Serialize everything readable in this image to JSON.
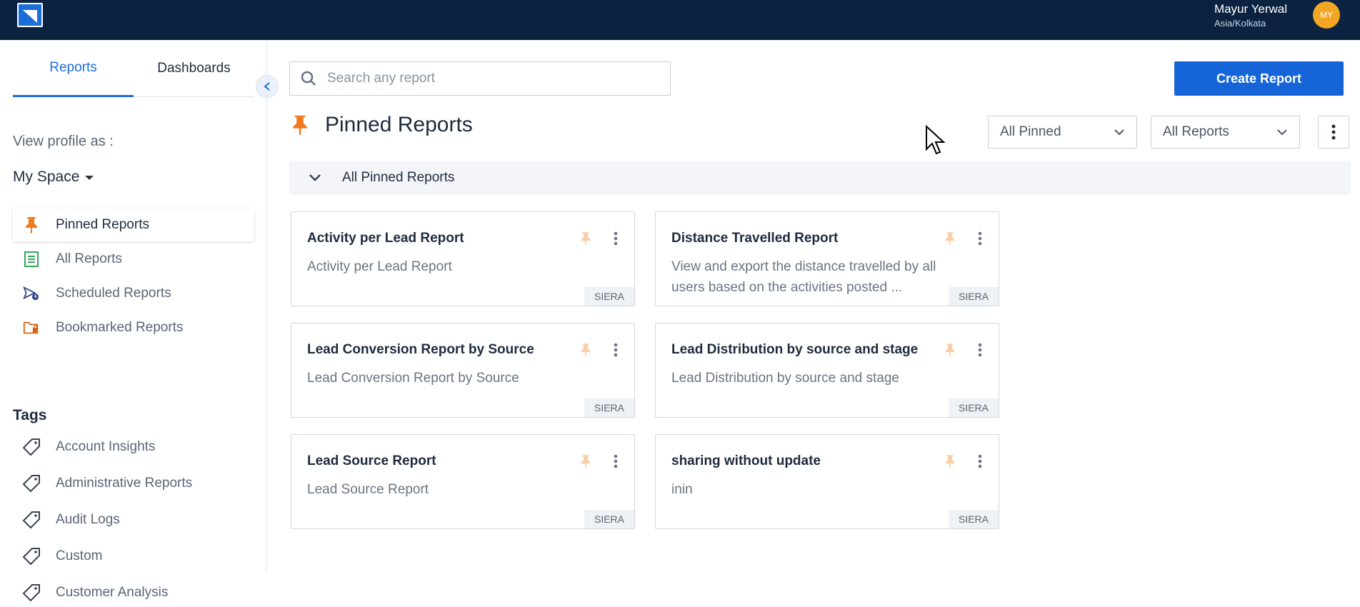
{
  "topbar": {
    "user_name": "Mayur Yerwal",
    "user_timezone": "Asia/Kolkata",
    "avatar_initials": "MY",
    "bg_color": "#0b2341",
    "avatar_color": "#f2a623"
  },
  "sidebar": {
    "tabs": [
      {
        "label": "Reports",
        "active": true
      },
      {
        "label": "Dashboards",
        "active": false
      }
    ],
    "view_profile_label": "View profile as :",
    "space_label": "My Space",
    "nav_items": [
      {
        "label": "Pinned Reports",
        "icon": "pin-icon",
        "active": true
      },
      {
        "label": "All Reports",
        "icon": "document-list-icon",
        "active": false
      },
      {
        "label": "Scheduled Reports",
        "icon": "send-clock-icon",
        "active": false
      },
      {
        "label": "Bookmarked Reports",
        "icon": "folder-lock-icon",
        "active": false
      }
    ],
    "tags_title": "Tags",
    "tags": [
      {
        "label": "Account Insights"
      },
      {
        "label": "Administrative Reports"
      },
      {
        "label": "Audit Logs"
      },
      {
        "label": "Custom"
      },
      {
        "label": "Customer Analysis"
      }
    ]
  },
  "main": {
    "search_placeholder": "Search any report",
    "create_button_label": "Create Report",
    "page_title": "Pinned Reports",
    "filter_pinned": "All Pinned",
    "filter_reports": "All Reports",
    "group_label": "All Pinned Reports",
    "accent_color": "#1565d8",
    "pin_color": "#f07b1d",
    "cards": [
      {
        "title": "Activity per Lead Report",
        "description": "Activity per Lead Report",
        "badge": "SIERA"
      },
      {
        "title": "Distance Travelled Report",
        "description": "View and export the distance travelled by all users based on the activities posted ...",
        "badge": "SIERA"
      },
      {
        "title": "Lead Conversion Report by Source",
        "description": "Lead Conversion Report by Source",
        "badge": "SIERA"
      },
      {
        "title": "Lead Distribution by source and stage",
        "description": "Lead Distribution by source and stage",
        "badge": "SIERA"
      },
      {
        "title": "Lead Source Report",
        "description": "Lead Source Report",
        "badge": "SIERA"
      },
      {
        "title": "sharing without update",
        "description": "inin",
        "badge": "SIERA"
      }
    ]
  }
}
